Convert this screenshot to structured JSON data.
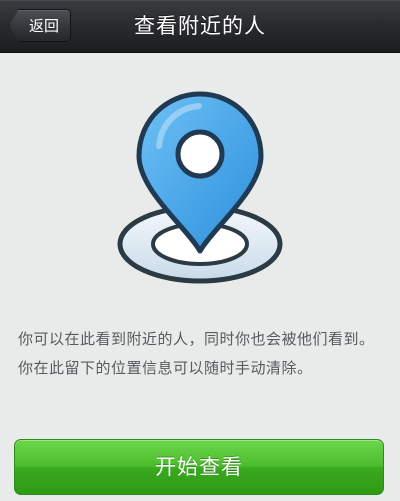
{
  "navbar": {
    "back_label": "返回",
    "title": "查看附近的人"
  },
  "illustration": {
    "icon": "location-pin-icon",
    "pin_color": "#3d9de6",
    "ring_color": "#dbe8f3"
  },
  "main": {
    "description": "你可以在此看到附近的人，同时你也会被他们看到。你在此留下的位置信息可以随时手动清除。",
    "start_label": "开始查看"
  },
  "colors": {
    "navbar_bg": "#2a2c2f",
    "page_bg": "#e9ebea",
    "button_green": "#4cbd2f",
    "text_gray": "#555b5e"
  }
}
